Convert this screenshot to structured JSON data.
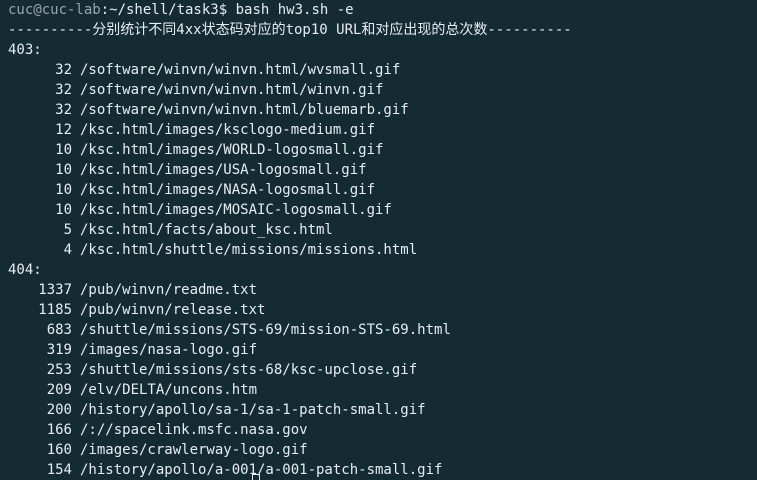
{
  "prompt": {
    "user_host": "cuc@cuc-lab",
    "path": ":~/shell/task3",
    "symbol": "$",
    "command": " bash hw3.sh -e"
  },
  "header": "----------分别统计不同4xx状态码对应的top10 URL和对应出现的总次数----------",
  "groups": [
    {
      "code": "403:",
      "rows": [
        {
          "count": "32",
          "url": "/software/winvn/winvn.html/wvsmall.gif"
        },
        {
          "count": "32",
          "url": "/software/winvn/winvn.html/winvn.gif"
        },
        {
          "count": "32",
          "url": "/software/winvn/winvn.html/bluemarb.gif"
        },
        {
          "count": "12",
          "url": "/ksc.html/images/ksclogo-medium.gif"
        },
        {
          "count": "10",
          "url": "/ksc.html/images/WORLD-logosmall.gif"
        },
        {
          "count": "10",
          "url": "/ksc.html/images/USA-logosmall.gif"
        },
        {
          "count": "10",
          "url": "/ksc.html/images/NASA-logosmall.gif"
        },
        {
          "count": "10",
          "url": "/ksc.html/images/MOSAIC-logosmall.gif"
        },
        {
          "count": "5",
          "url": "/ksc.html/facts/about_ksc.html"
        },
        {
          "count": "4",
          "url": "/ksc.html/shuttle/missions/missions.html"
        }
      ]
    },
    {
      "code": "404:",
      "rows": [
        {
          "count": "1337",
          "url": "/pub/winvn/readme.txt"
        },
        {
          "count": "1185",
          "url": "/pub/winvn/release.txt"
        },
        {
          "count": "683",
          "url": "/shuttle/missions/STS-69/mission-STS-69.html"
        },
        {
          "count": "319",
          "url": "/images/nasa-logo.gif"
        },
        {
          "count": "253",
          "url": "/shuttle/missions/sts-68/ksc-upclose.gif"
        },
        {
          "count": "209",
          "url": "/elv/DELTA/uncons.htm"
        },
        {
          "count": "200",
          "url": "/history/apollo/sa-1/sa-1-patch-small.gif"
        },
        {
          "count": "166",
          "url": "/://spacelink.msfc.nasa.gov"
        },
        {
          "count": "160",
          "url": "/images/crawlerway-logo.gif"
        },
        {
          "count": "154",
          "url": "/history/apollo/a-001/a-001-patch-small.gif"
        }
      ]
    }
  ]
}
